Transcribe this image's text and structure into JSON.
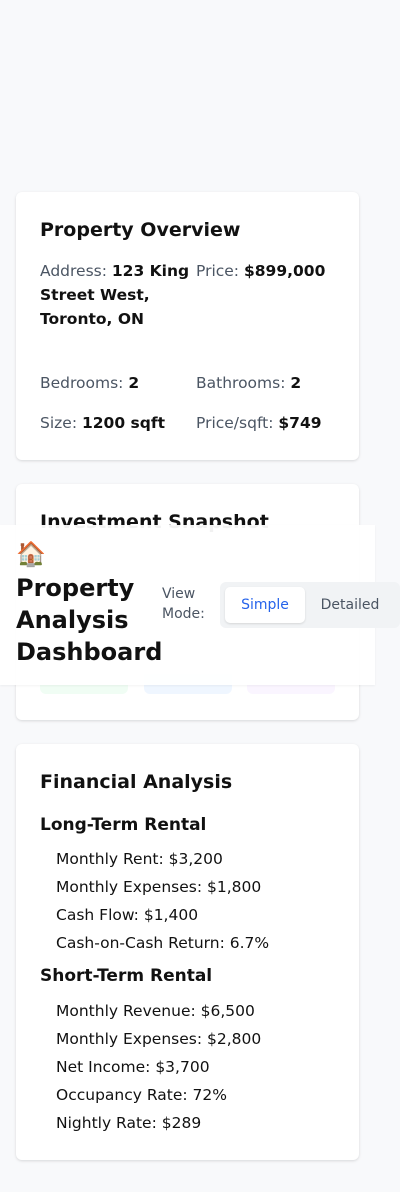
{
  "app": {
    "logo_icon": "house-icon",
    "logo_glyph": "🏠",
    "title": "Property Analysis Dashboard"
  },
  "view_mode": {
    "label": "View Mode:",
    "options": [
      "Simple",
      "Detailed"
    ],
    "selected": "Simple",
    "accent_color": "#2563eb"
  },
  "overview": {
    "title": "Property Overview",
    "address_label": "Address:",
    "address_value": "123 King Street West, Toronto, ON",
    "price_label": "Price:",
    "price_value": "$899,000",
    "bedrooms_label": "Bedrooms:",
    "bedrooms_value": "2",
    "bathrooms_label": "Bathrooms:",
    "bathrooms_value": "2",
    "size_label": "Size:",
    "size_value": "1200 sqft",
    "price_sqft_label": "Price/sqft:",
    "price_sqft_value": "$749"
  },
  "snapshot": {
    "title": "Investment Snapshot",
    "tile_colors": [
      "#f0fdf4",
      "#eff6ff",
      "#faf5ff"
    ]
  },
  "financial": {
    "title": "Financial Analysis",
    "long_term": {
      "title": "Long-Term Rental",
      "lines": [
        "Monthly Rent: $3,200",
        "Monthly Expenses: $1,800",
        "Cash Flow: $1,400",
        "Cash-on-Cash Return: 6.7%"
      ]
    },
    "short_term": {
      "title": "Short-Term Rental",
      "lines": [
        "Monthly Revenue: $6,500",
        "Monthly Expenses: $2,800",
        "Net Income: $3,700",
        "Occupancy Rate: 72%",
        "Nightly Rate: $289"
      ]
    }
  }
}
